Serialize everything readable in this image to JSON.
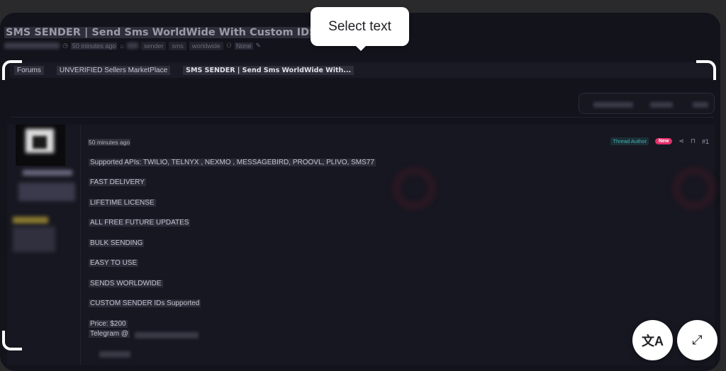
{
  "thread": {
    "title": "SMS SENDER | Send Sms WorldWide With Custom IDS",
    "time": "50 minutes ago",
    "tags": [
      "sender",
      "sms",
      "worldwide"
    ],
    "audience": "None"
  },
  "breadcrumb": [
    "Forums",
    "UNVERIFIED Sellers MarketPlace",
    "SMS SENDER | Send Sms WorldWide With..."
  ],
  "post": {
    "time": "50 minutes ago",
    "author_badge": "Thread Author",
    "new_badge": "New",
    "post_number": "#1",
    "lines": [
      "Supported APIs: TWILIO, TELNYX , NEXMO , MESSAGEBIRD, PROOVL, PLIVO, SMS77",
      "FAST DELIVERY",
      "LIFETIME LICENSE",
      "ALL FREE FUTURE UPDATES",
      "BULK SENDING",
      "EASY TO USE",
      "SENDS WORLDWIDE",
      "CUSTOM SENDER IDs Supported",
      "Price: $200",
      "Telegram @"
    ]
  },
  "overlay": {
    "tooltip": "Select text",
    "translate_icon": "translate-icon",
    "expand_icon": "expand-icon"
  },
  "colors": {
    "new_badge": "#e0306a",
    "author_badge": "#3fb5b0",
    "background": "#13131c"
  }
}
